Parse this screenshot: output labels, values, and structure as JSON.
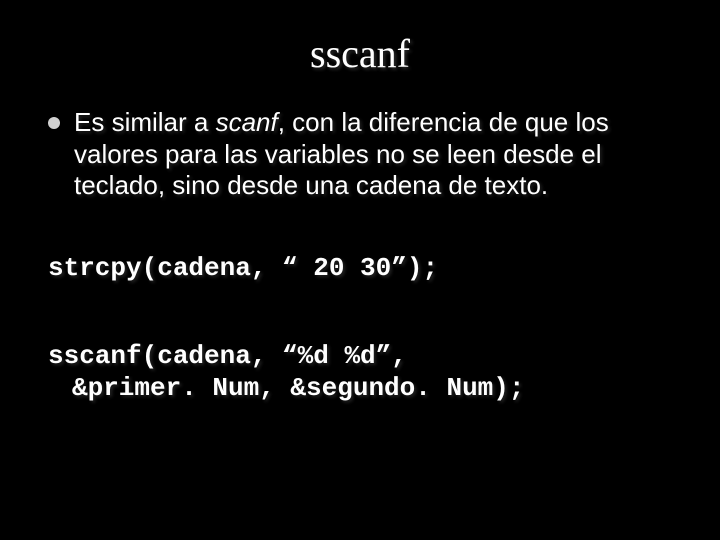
{
  "title": "sscanf",
  "bullet": {
    "pre_italic": "Es similar a ",
    "italic": "scanf",
    "post_italic": ", con la diferencia de que los valores para las variables no se leen desde el teclado, sino desde una cadena de texto."
  },
  "code": {
    "line1": "strcpy(cadena, “ 20 30”);",
    "line2a": "sscanf(cadena, “%d %d”,",
    "line2b": "&primer. Num, &segundo. Num);"
  }
}
